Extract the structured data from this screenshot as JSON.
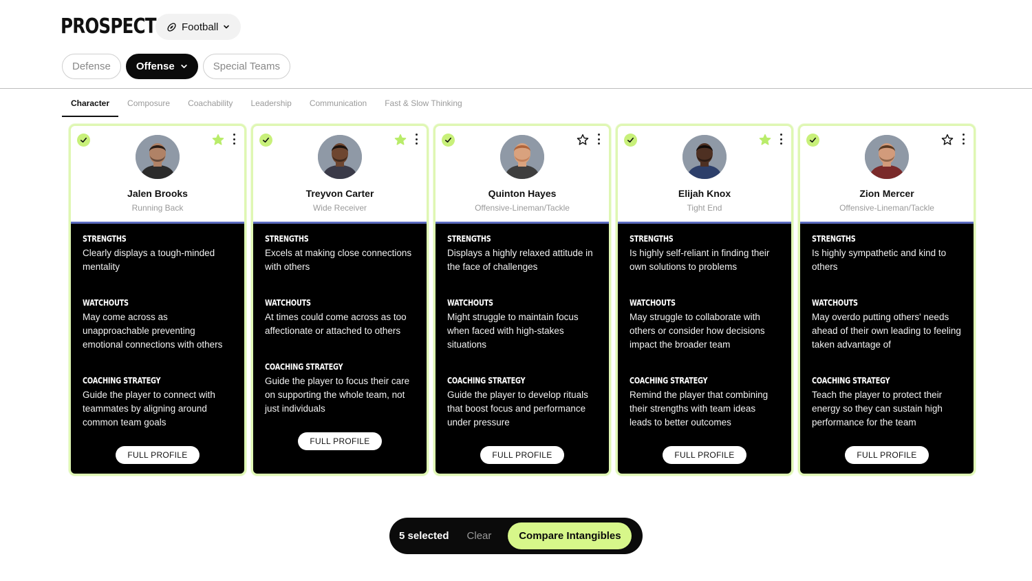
{
  "header": {
    "title": "PROSPECTS",
    "sport_label": "Football",
    "sport_icon": "football-icon"
  },
  "unit_tabs": [
    {
      "label": "Defense",
      "active": false
    },
    {
      "label": "Offense",
      "active": true
    },
    {
      "label": "Special Teams",
      "active": false
    }
  ],
  "trait_tabs": [
    {
      "label": "Character",
      "active": true
    },
    {
      "label": "Composure",
      "active": false
    },
    {
      "label": "Coachability",
      "active": false
    },
    {
      "label": "Leadership",
      "active": false
    },
    {
      "label": "Communication",
      "active": false
    },
    {
      "label": "Fast & Slow Thinking",
      "active": false
    }
  ],
  "section_titles": {
    "strengths": "STRENGTHS",
    "watchouts": "WATCHOUTS",
    "coaching": "COACHING STRATEGY"
  },
  "full_profile_label": "FULL PROFILE",
  "colors": {
    "accent_green": "#d7f78a",
    "check_green": "#c8f07a",
    "card_border": "#dff7b3",
    "card_body": "#000000",
    "star_filled": "#b9ec6a"
  },
  "players": [
    {
      "name": "Jalen Brooks",
      "position": "Running Back",
      "selected": true,
      "favorite": true,
      "skin": "#b08266",
      "hair": "#2a1d15",
      "jersey": "#2b2b2b",
      "strengths": "Clearly displays a tough-minded mentality",
      "watchouts": "May come across as unapproachable preventing emotional connections with others",
      "coaching": "Guide the player to connect with teammates by aligning around common team goals"
    },
    {
      "name": "Treyvon Carter",
      "position": "Wide Receiver",
      "selected": true,
      "favorite": true,
      "skin": "#6e4630",
      "hair": "#1a120d",
      "jersey": "#3a3a48",
      "strengths": "Excels at making close connections with others",
      "watchouts": "At times could come across as too affectionate or attached to others",
      "coaching": "Guide the player to focus their care on supporting the whole team, not just individuals"
    },
    {
      "name": "Quinton Hayes",
      "position": "Offensive-Lineman/Tackle",
      "selected": true,
      "favorite": false,
      "skin": "#d9a27e",
      "hair": "#b0643a",
      "jersey": "#3e3e3e",
      "strengths": "Displays a highly relaxed attitude in the face of challenges",
      "watchouts": "Might struggle to maintain focus when faced with high-stakes situations",
      "coaching": "Guide the player to develop rituals that boost focus and performance under pressure"
    },
    {
      "name": "Elijah Knox",
      "position": "Tight End",
      "selected": true,
      "favorite": true,
      "skin": "#4e3022",
      "hair": "#120c09",
      "jersey": "#2d3f6a",
      "strengths": "Is highly self-reliant in finding their own solutions to problems",
      "watchouts": "May struggle to collaborate with others or consider how decisions impact the broader team",
      "coaching": "Remind the player that combining their strengths with team ideas leads to better outcomes"
    },
    {
      "name": "Zion Mercer",
      "position": "Offensive-Lineman/Tackle",
      "selected": true,
      "favorite": false,
      "skin": "#d29b7b",
      "hair": "#5a3a22",
      "jersey": "#7a2a2a",
      "strengths": "Is highly sympathetic and kind to others",
      "watchouts": "May overdo putting others' needs ahead of their own leading to feeling taken advantage of",
      "coaching": "Teach the player to protect their energy so they can sustain high performance for the team"
    }
  ],
  "selection_bar": {
    "count_label": "5 selected",
    "clear_label": "Clear",
    "compare_label": "Compare Intangibles"
  }
}
